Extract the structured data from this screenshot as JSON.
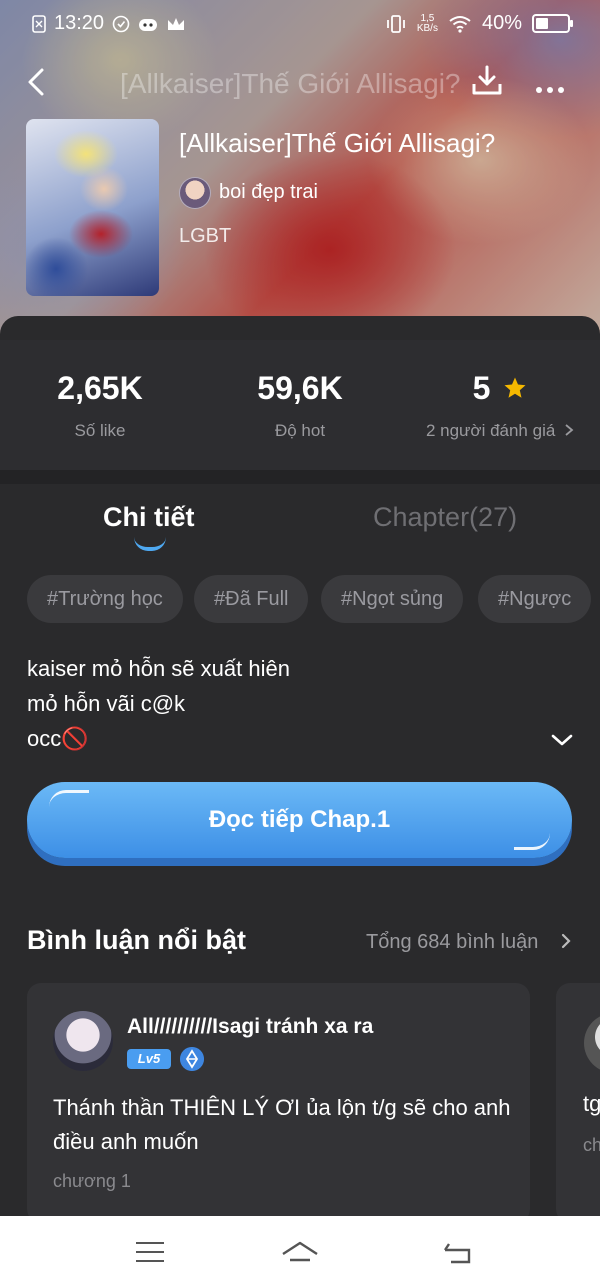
{
  "status_bar": {
    "time": "13:20",
    "network_speed": "1,5\nKB/s",
    "network_speed_top": "1,5",
    "network_speed_bottom": "KB/s",
    "battery": "40%"
  },
  "header": {
    "title_ghost": "[Allkaiser]Thế Giới Allisagi?",
    "icons": [
      "back-icon",
      "download-icon",
      "more-icon"
    ]
  },
  "book": {
    "title": "[Allkaiser]Thế Giới Allisagi?",
    "author": "boi đẹp trai",
    "genre": "LGBT"
  },
  "stats": {
    "likes_value": "2,65K",
    "likes_label": "Số like",
    "hot_value": "59,6K",
    "hot_label": "Độ hot",
    "rating_value": "5",
    "rating_label": "2 người đánh giá",
    "star_color": "#f5b800"
  },
  "tabs": {
    "details": "Chi tiết",
    "chapters": "Chapter(27)"
  },
  "tags": [
    "#Trường học",
    "#Đã Full",
    "#Ngọt sủng",
    "#Ngược"
  ],
  "description": {
    "line1": "kaiser mỏ hỗn sẽ xuất hiên",
    "line2": "mỏ hỗn vãi c@k",
    "line3": "occ🚫"
  },
  "read_button": {
    "label": "Đọc tiếp Chap.1",
    "color": "#4a9cf0"
  },
  "comments": {
    "section_title": "Bình luận nổi bật",
    "total": "Tổng 684 bình luận",
    "items": [
      {
        "user": "All//////////Isagi tránh xa ra",
        "level": "Lv5",
        "text": "Thánh thần THIÊN LÝ ƠI ủa lộn t/g sẽ cho anh điều anh muốn",
        "chapter": "chương 1"
      },
      {
        "text": "tg",
        "chapter": "ch"
      }
    ]
  },
  "nav_bar": {
    "icons": [
      "menu-icon",
      "home-icon",
      "return-icon"
    ]
  }
}
